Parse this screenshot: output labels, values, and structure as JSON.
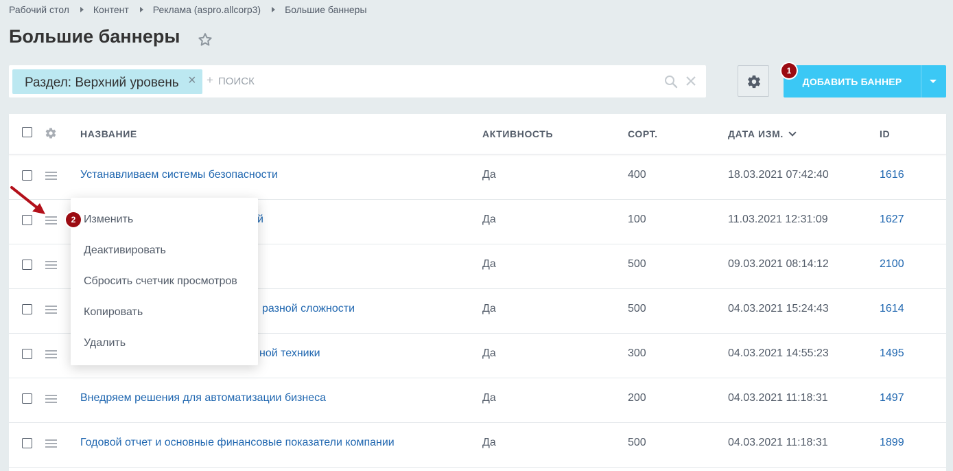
{
  "breadcrumb": [
    "Рабочий стол",
    "Контент",
    "Реклама (aspro.allcorp3)",
    "Большие баннеры"
  ],
  "page": {
    "title": "Большие баннеры"
  },
  "filter": {
    "chip_label": "Раздел: Верхний уровень",
    "chip_close": "×",
    "plus": "+",
    "search_placeholder": "ПОИСК"
  },
  "toolbar": {
    "add_label": "ДОБАВИТЬ БАННЕР"
  },
  "markers": {
    "m1": "1",
    "m2": "2"
  },
  "columns": {
    "name": "НАЗВАНИЕ",
    "active": "АКТИВНОСТЬ",
    "sort": "СОРТ.",
    "date": "ДАТА ИЗМ.",
    "id": "ID"
  },
  "rows": [
    {
      "name": "Устанавливаем системы безопасности",
      "active": "Да",
      "sort": "400",
      "date": "18.03.2021 07:42:40",
      "id": "1616"
    },
    {
      "name": "й",
      "active": "Да",
      "sort": "100",
      "date": "11.03.2021 12:31:09",
      "id": "1627"
    },
    {
      "name": "",
      "active": "Да",
      "sort": "500",
      "date": "09.03.2021 08:14:12",
      "id": "2100"
    },
    {
      "name": "разной сложности",
      "active": "Да",
      "sort": "500",
      "date": "04.03.2021 15:24:43",
      "id": "1614"
    },
    {
      "name": "ной техники",
      "active": "Да",
      "sort": "300",
      "date": "04.03.2021 14:55:23",
      "id": "1495"
    },
    {
      "name": "Внедряем решения для автоматизации бизнеса",
      "active": "Да",
      "sort": "200",
      "date": "04.03.2021 11:18:31",
      "id": "1497"
    },
    {
      "name": "Годовой отчет и основные финансовые показатели компании",
      "active": "Да",
      "sort": "500",
      "date": "04.03.2021 11:18:31",
      "id": "1899"
    }
  ],
  "context_menu": [
    "Изменить",
    "Деактивировать",
    "Сбросить счетчик просмотров",
    "Копировать",
    "Удалить"
  ],
  "colors": {
    "accent": "#3bc8f5",
    "link": "#2067b0",
    "marker": "#9b0b12",
    "chip": "#bce8f1",
    "arrow": "#b3101a"
  }
}
